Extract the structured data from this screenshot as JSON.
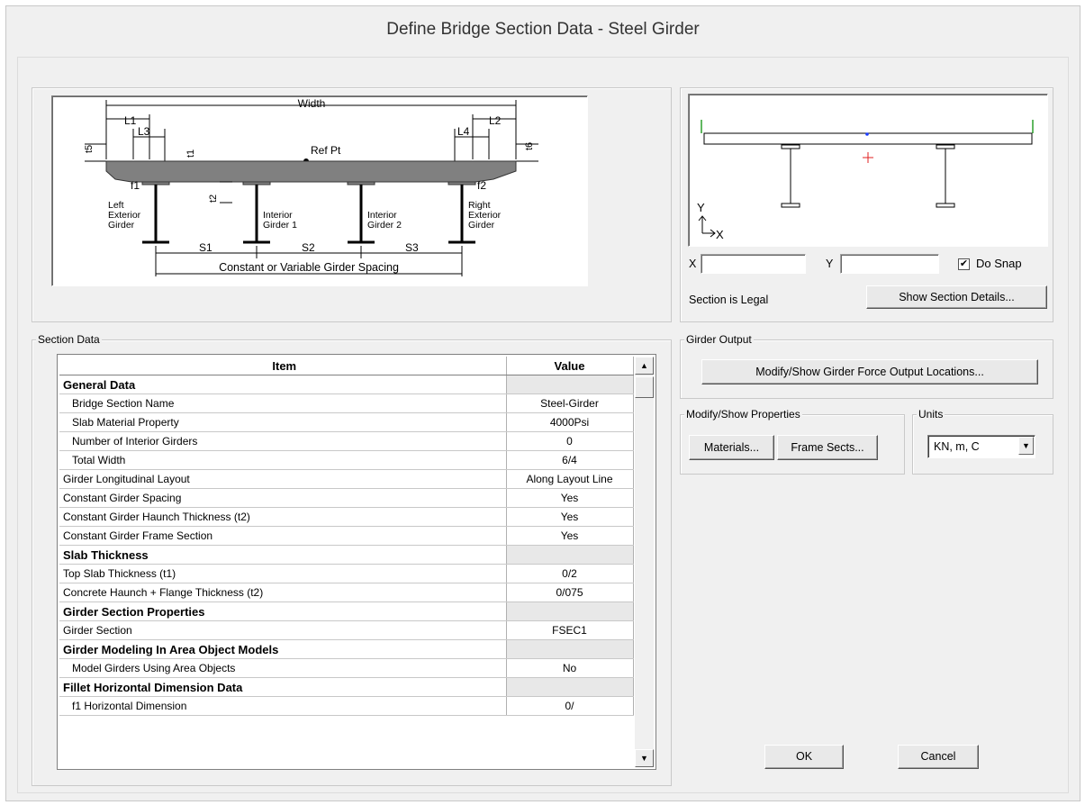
{
  "window": {
    "title": "Define Bridge Section Data - Steel Girder"
  },
  "diagram": {
    "width_label": "Width",
    "l1": "L1",
    "l2": "L2",
    "l3": "L3",
    "l4": "L4",
    "t1": "t1",
    "t2": "t2",
    "t5": "t5",
    "t6": "t6",
    "f1": "f1",
    "f2": "f2",
    "ref_pt": "Ref Pt",
    "left_girder": [
      "Left",
      "Exterior",
      "Girder"
    ],
    "int1_girder": [
      "Interior",
      "Girder 1"
    ],
    "int2_girder": [
      "Interior",
      "Girder 2"
    ],
    "right_girder": [
      "Right",
      "Exterior",
      "Girder"
    ],
    "s1": "S1",
    "s2": "S2",
    "s3": "S3",
    "spacing_label": "Constant or Variable Girder Spacing"
  },
  "preview": {
    "axis_y": "Y",
    "axis_x": "X",
    "x_label": "X",
    "y_label": "Y",
    "x_value": "",
    "y_value": "",
    "do_snap_label": "Do Snap",
    "do_snap_checked": true,
    "status": "Section is Legal",
    "show_details_button": "Show Section Details..."
  },
  "section_data": {
    "group_label": "Section Data",
    "headers": {
      "item": "Item",
      "value": "Value"
    },
    "rows": [
      {
        "item": "General Data",
        "value": "",
        "kind": "sec"
      },
      {
        "item": "Bridge Section Name",
        "value": "Steel-Girder",
        "kind": "indent"
      },
      {
        "item": "Slab Material Property",
        "value": "4000Psi",
        "kind": "indent"
      },
      {
        "item": "Number of Interior Girders",
        "value": "0",
        "kind": "indent"
      },
      {
        "item": "Total Width",
        "value": "6/4",
        "kind": "indent"
      },
      {
        "item": "Girder Longitudinal Layout",
        "value": "Along Layout Line",
        "kind": "row"
      },
      {
        "item": "Constant Girder Spacing",
        "value": "Yes",
        "kind": "row"
      },
      {
        "item": "Constant Girder Haunch Thickness (t2)",
        "value": "Yes",
        "kind": "row"
      },
      {
        "item": "Constant Girder Frame Section",
        "value": "Yes",
        "kind": "row"
      },
      {
        "item": "Slab Thickness",
        "value": "",
        "kind": "sec"
      },
      {
        "item": "Top Slab Thickness (t1)",
        "value": "0/2",
        "kind": "row"
      },
      {
        "item": "Concrete Haunch + Flange Thickness (t2)",
        "value": "0/075",
        "kind": "row"
      },
      {
        "item": "Girder Section Properties",
        "value": "",
        "kind": "sec"
      },
      {
        "item": "Girder Section",
        "value": "FSEC1",
        "kind": "row"
      },
      {
        "item": "Girder Modeling In Area Object Models",
        "value": "",
        "kind": "sec"
      },
      {
        "item": "Model Girders Using Area Objects",
        "value": "No",
        "kind": "indent"
      },
      {
        "item": "Fillet Horizontal Dimension Data",
        "value": "",
        "kind": "sec"
      },
      {
        "item": "f1 Horizontal Dimension",
        "value": "0/",
        "kind": "indent"
      }
    ]
  },
  "girder_output": {
    "group_label": "Girder Output",
    "button": "Modify/Show Girder Force Output Locations..."
  },
  "properties": {
    "group_label": "Modify/Show Properties",
    "materials_button": "Materials...",
    "frame_sects_button": "Frame Sects..."
  },
  "units": {
    "group_label": "Units",
    "selected": "KN, m, C"
  },
  "footer": {
    "ok": "OK",
    "cancel": "Cancel"
  },
  "colors": {
    "dialog_bg": "#f0f0f0",
    "deck_fill": "#808080",
    "snap_line": "#2ca02c",
    "ref_marker": "#e02020"
  }
}
